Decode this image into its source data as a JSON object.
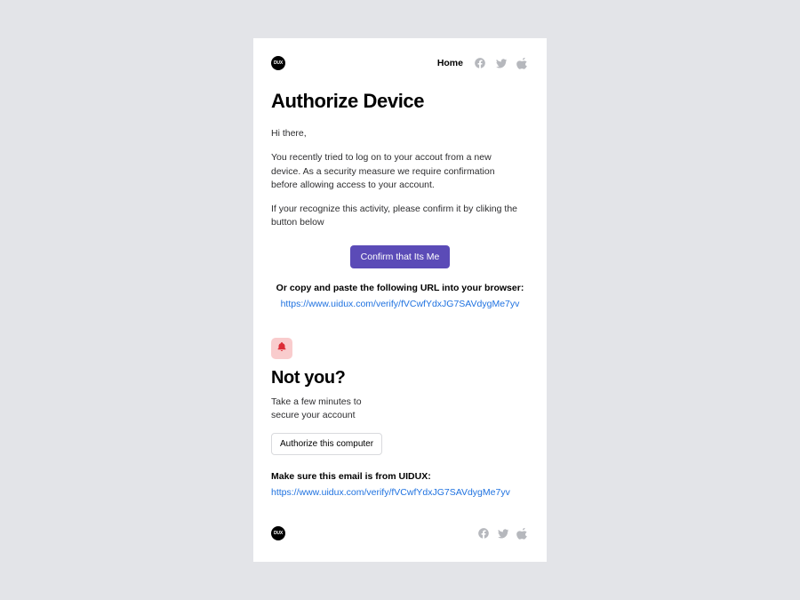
{
  "logo_text": "DUX",
  "header": {
    "home_label": "Home"
  },
  "title": "Authorize Device",
  "greeting": "Hi there,",
  "paragraph1": "You recently tried to log on to your accout from a new device. As a security measure we require confirmation before allowing access to your account.",
  "paragraph2": "If your recognize this activity, please confirm it by cliking the button below",
  "cta_label": "Confirm that Its Me",
  "url_section": {
    "label": "Or copy and paste the following URL into your browser:",
    "url": "https://www.uidux.com/verify/fVCwfYdxJG7SAVdygMe7yv"
  },
  "not_you": {
    "title": "Not you?",
    "copy": "Take a few minutes to secure your account",
    "button_label": "Authorize this computer"
  },
  "verify_section": {
    "label": "Make sure this email is from UIDUX:",
    "url": "https://www.uidux.com/verify/fVCwfYdxJG7SAVdygMe7yv"
  }
}
